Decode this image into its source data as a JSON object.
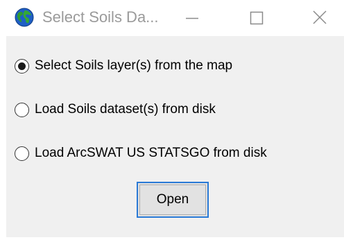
{
  "window": {
    "title": "Select Soils Da...",
    "app_icon": "globe-icon",
    "caption_buttons": [
      "minimize-icon",
      "maximize-icon",
      "close-icon"
    ]
  },
  "options": [
    {
      "label": "Select Soils layer(s) from the map",
      "selected": true
    },
    {
      "label": "Load Soils dataset(s) from disk",
      "selected": false
    },
    {
      "label": "Load ArcSWAT US STATSGO from disk",
      "selected": false
    }
  ],
  "open_button": {
    "label": "Open"
  },
  "colors": {
    "client_bg": "#f0f0f0",
    "focus_border": "#2a7ad6",
    "title_text": "#9a9a9a"
  }
}
